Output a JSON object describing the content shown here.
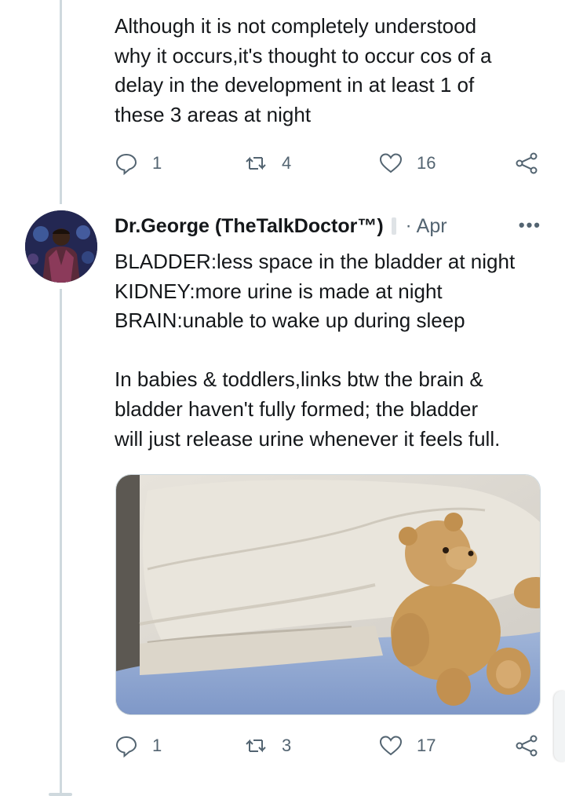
{
  "tweet1": {
    "text": "Although it is not completely understood\nwhy it occurs,it's thought to occur cos of a\ndelay in the development in at least 1 of\nthese 3 areas at night",
    "actions": {
      "reply_count": "1",
      "retweet_count": "4",
      "like_count": "16"
    }
  },
  "tweet2": {
    "author_name": "Dr.George (TheTalkDoctor™)",
    "date_separator": "·",
    "date": "Apr",
    "more_label": "•••",
    "text": "BLADDER:less space in the bladder at night\nKIDNEY:more urine is made at night\nBRAIN:unable to wake up during sleep\n\nIn babies & toddlers,links btw the brain &\nbladder haven't fully formed; the bladder\nwill just release urine whenever it feels full.",
    "media": {
      "subject": "teddy bear on pillow"
    },
    "actions": {
      "reply_count": "1",
      "retweet_count": "3",
      "like_count": "17"
    }
  },
  "icons": {
    "reply": "reply-icon",
    "retweet": "retweet-icon",
    "like": "heart-icon",
    "share": "share-icon"
  },
  "colors": {
    "text": "#14171a",
    "secondary": "#536471",
    "thread_line": "#cfd9de"
  }
}
